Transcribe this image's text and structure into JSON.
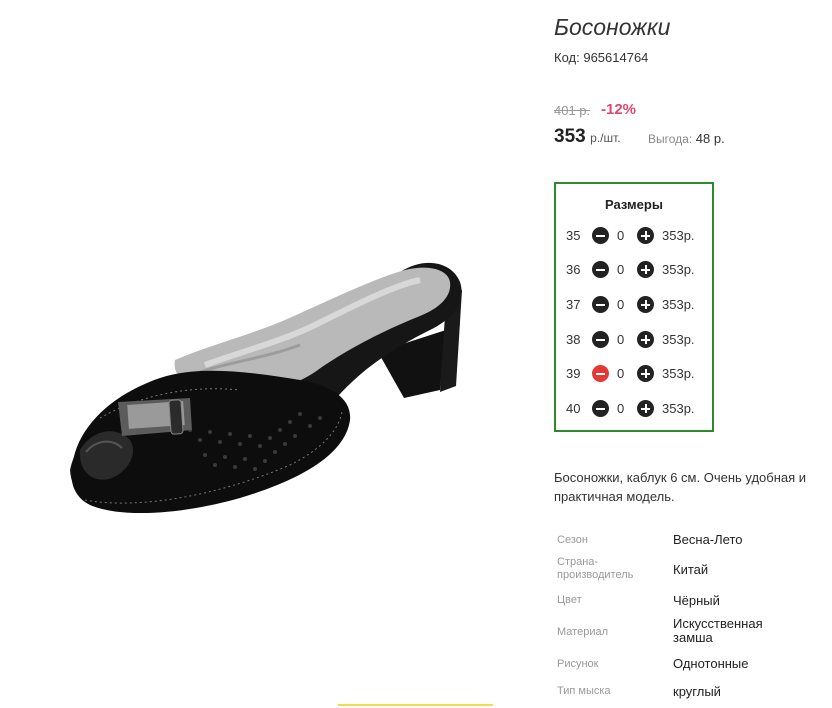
{
  "product": {
    "title": "Босоножки",
    "code_label": "Код:",
    "code_value": "965614764",
    "old_price": "401 р.",
    "discount": "-12%",
    "price": "353",
    "price_unit": "р./шт.",
    "saving_label": "Выгода:",
    "saving_value": "48 р."
  },
  "sizes": {
    "title": "Размеры",
    "rows": [
      {
        "size": "35",
        "qty": "0",
        "price": "353р."
      },
      {
        "size": "36",
        "qty": "0",
        "price": "353р."
      },
      {
        "size": "37",
        "qty": "0",
        "price": "353р."
      },
      {
        "size": "38",
        "qty": "0",
        "price": "353р."
      },
      {
        "size": "39",
        "qty": "0",
        "price": "353р."
      },
      {
        "size": "40",
        "qty": "0",
        "price": "353р."
      }
    ]
  },
  "description": "Босоножки, каблук 6 см. Очень удобная и практичная модель.",
  "attributes": [
    {
      "label": "Сезон",
      "value": "Весна-Лето"
    },
    {
      "label": "Страна-производитель",
      "value": "Китай"
    },
    {
      "label": "Цвет",
      "value": "Чёрный"
    },
    {
      "label": "Материал",
      "value": "Искусственная замша"
    },
    {
      "label": "Рисунок",
      "value": "Однотонные"
    },
    {
      "label": "Тип мыска",
      "value": "круглый"
    }
  ],
  "colors": {
    "accent_green": "#2b8a2b",
    "discount_pink": "#e0476e",
    "minus_active_red": "#e53935"
  }
}
